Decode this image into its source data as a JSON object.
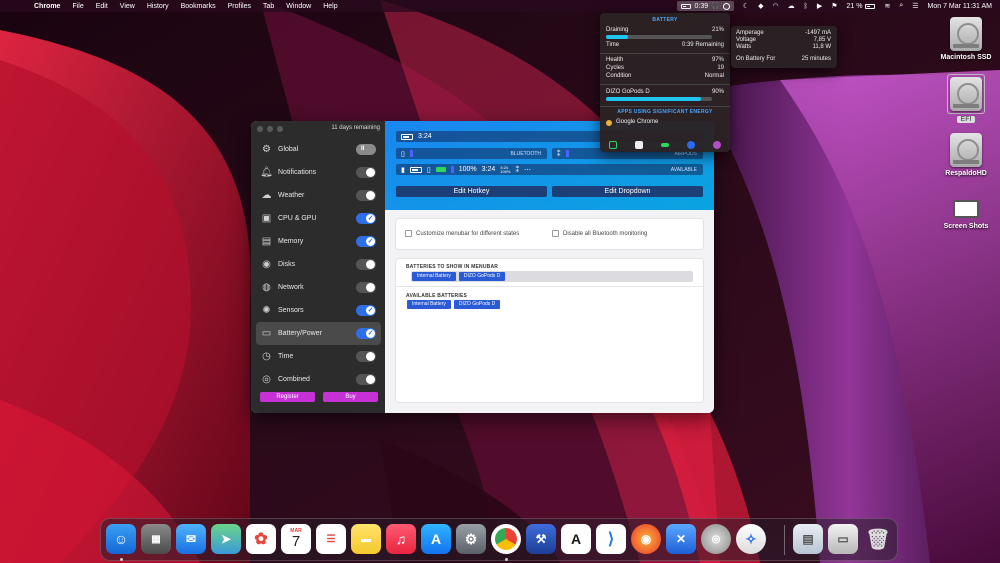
{
  "menubar": {
    "app_name": "Chrome",
    "menus": [
      "File",
      "Edit",
      "View",
      "History",
      "Bookmarks",
      "Profiles",
      "Tab",
      "Window",
      "Help"
    ],
    "battery_time": "0:39",
    "battery_percent": "21 %",
    "date_time": "Mon 7 Mar  11:31 AM"
  },
  "desktop_icons": [
    {
      "label": "Macintosh SSD"
    },
    {
      "label": "EFI"
    },
    {
      "label": "RespaldoHD"
    },
    {
      "label": "Screen Shots"
    }
  ],
  "app": {
    "days_remaining": "11 days remaining",
    "sidebar": [
      {
        "label": "Global",
        "icon": "gear-icon",
        "toggle": "pause"
      },
      {
        "label": "Notifications",
        "icon": "bell-icon",
        "toggle": "off"
      },
      {
        "label": "Weather",
        "icon": "cloud-sun-icon",
        "toggle": "off"
      },
      {
        "label": "CPU & GPU",
        "icon": "chip-icon",
        "toggle": "on"
      },
      {
        "label": "Memory",
        "icon": "memory-icon",
        "toggle": "on"
      },
      {
        "label": "Disks",
        "icon": "disk-icon",
        "toggle": "off"
      },
      {
        "label": "Network",
        "icon": "globe-icon",
        "toggle": "off"
      },
      {
        "label": "Sensors",
        "icon": "fan-icon",
        "toggle": "on"
      },
      {
        "label": "Battery/Power",
        "icon": "battery-icon",
        "toggle": "on",
        "selected": true
      },
      {
        "label": "Time",
        "icon": "clock-icon",
        "toggle": "off"
      },
      {
        "label": "Combined",
        "icon": "rings-icon",
        "toggle": "off"
      }
    ],
    "register_label": "Register",
    "buy_label": "Buy",
    "preview": {
      "row1_time": "3:24",
      "bluetooth_tag": "BLUETOOTH",
      "airpods_tag": "AIRPODS",
      "available_tag": "AVAILABLE",
      "combined_percent": "100%",
      "combined_time": "3:24",
      "combined_small_top": "3:24",
      "combined_small_bottom": "100%"
    },
    "edit_hotkey_label": "Edit Hotkey",
    "edit_dropdown_label": "Edit Dropdown",
    "customize_label": "Customize menubar for different states",
    "disable_bt_label": "Disable all Bluetooth monitoring",
    "menubar_batteries_title": "BATTERIES TO SHOW IN MENUBAR",
    "menubar_batteries": [
      "Internal Battery",
      "DIZO GoPods D"
    ],
    "available_batteries_title": "AVAILABLE BATTERIES",
    "available_batteries": [
      "Internal Battery",
      "DIZO GoPods D"
    ]
  },
  "popover": {
    "title": "BATTERY",
    "status": "Draining",
    "percent": "21%",
    "percent_value": 0.21,
    "time_label": "Time",
    "time_value": "0:39 Remaining",
    "health_label": "Health",
    "health_value": "97%",
    "cycles_label": "Cycles",
    "cycles_value": "19",
    "condition_label": "Condition",
    "condition_value": "Normal",
    "device_name": "DIZO GoPods D",
    "device_percent": "90%",
    "device_percent_value": 0.9,
    "energy_title": "APPS USING SIGNIFICANT ENERGY",
    "energy_app": "Google Chrome"
  },
  "subpopover": {
    "amperage_label": "Amperage",
    "amperage_value": "-1497 mA",
    "voltage_label": "Voltage",
    "voltage_value": "7,85 V",
    "watts_label": "Watts",
    "watts_value": "11,8 W",
    "on_battery_label": "On Battery For",
    "on_battery_value": "25 minutes"
  },
  "dock": {
    "calendar_month": "MAR",
    "calendar_day": "7"
  }
}
